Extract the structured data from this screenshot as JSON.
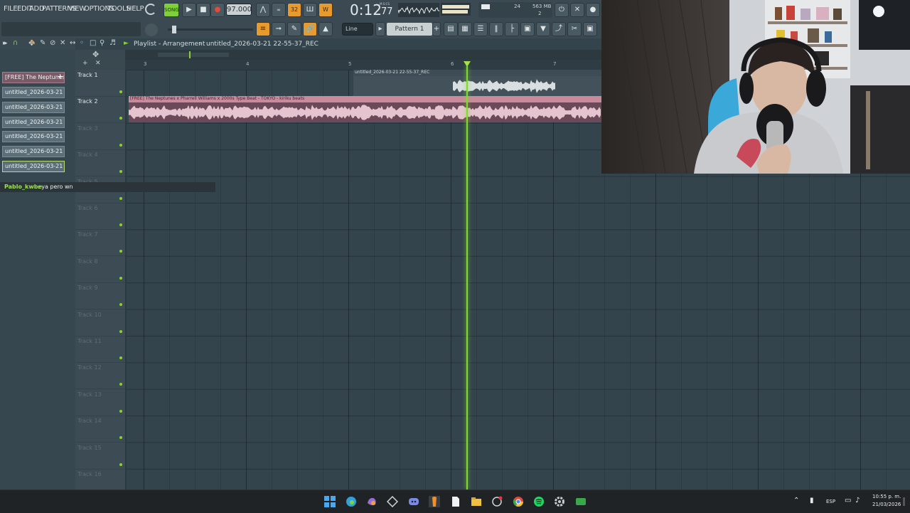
{
  "menu": [
    "FILE",
    "EDIT",
    "ADD",
    "PATTERNS",
    "VIEW",
    "OPTIONS",
    "TOOLS",
    "HELP"
  ],
  "transport": {
    "mode_label": "SONG",
    "tempo": "97.000",
    "time": "0:12",
    "time_ms": "77",
    "time_unit": "M:S:CS",
    "pattern_step": "32",
    "cpu_value": "24",
    "memory": "563 MB",
    "voices": "2"
  },
  "toolbar2": {
    "snap": "Line",
    "pattern": "Pattern 1"
  },
  "playlist": {
    "title": "Playlist - Arrangement",
    "project": "untitled_2026-03-21 22-55-37_REC",
    "ruler": [
      "3",
      "4",
      "5",
      "6",
      "7"
    ]
  },
  "browser": {
    "items": [
      "[FREE] The Neptunes...",
      "untitled_2026-03-21 22-...",
      "untitled_2026-03-21 22-...",
      "untitled_2026-03-21 22-...",
      "untitled_2026-03-21 22-...",
      "untitled_2026-03-21 22-...",
      "untitled_2026-03-21 22-..."
    ]
  },
  "tracks": [
    "Track 1",
    "Track 2",
    "Track 3",
    "Track 4",
    "Track 5",
    "Track 6",
    "Track 7",
    "Track 8",
    "Track 9",
    "Track 10",
    "Track 11",
    "Track 12",
    "Track 13",
    "Track 14",
    "Track 15",
    "Track 16"
  ],
  "clips": {
    "rec_clip": "untitled_2026-03-21 22-55-37_REC",
    "beat_clip": "[FREE] The Neptunes x Pharrell Williams x 2000s Type Beat - TOKYO - kiriku beats"
  },
  "chat": {
    "user": "Pablo_kwbe",
    "message": ": ya pero wn"
  },
  "taskbar": {
    "lang": "ESP",
    "time": "10:55 p. m.",
    "date": "21/03/2026"
  },
  "colors": {
    "accent_green": "#7edc2a",
    "waveform_pink": "#e6c4cf",
    "clip_header": "#c98a9c",
    "orange": "#e89a2c"
  }
}
